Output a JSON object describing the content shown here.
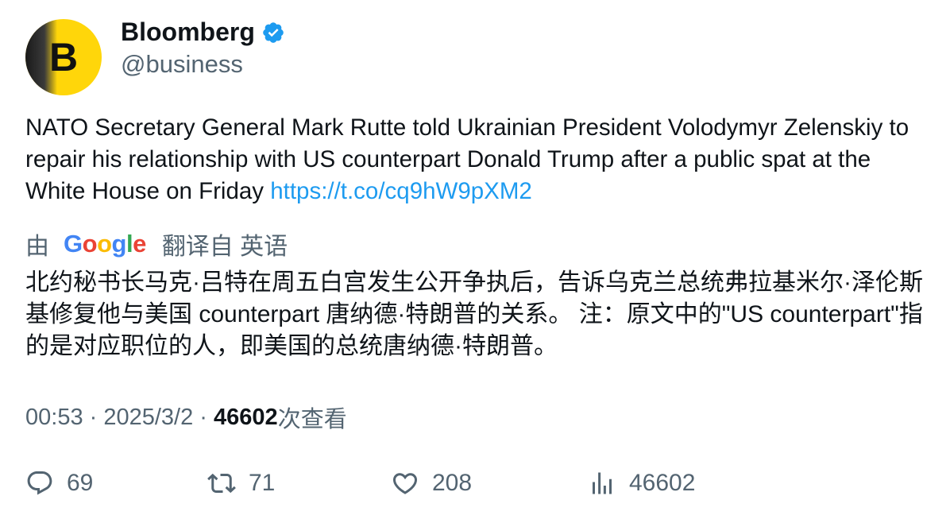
{
  "author": {
    "display_name": "Bloomberg",
    "handle": "@business",
    "avatar_letter": "B",
    "verified": true,
    "verified_color": "#1d9bf0",
    "avatar_color": "#ffd60a"
  },
  "tweet": {
    "text": "NATO Secretary General Mark Rutte told Ukrainian President Volodymyr Zelenskiy to repair his relationship with US counterpart Donald Trump after a public spat at the White House on Friday ",
    "link": "https://t.co/cq9hW9pXM2",
    "link_color": "#1d9bf0"
  },
  "translation": {
    "prefix": "由",
    "provider": "Google",
    "suffix": "翻译自 英语",
    "text": "北约秘书长马克·吕特在周五白宫发生公开争执后，告诉乌克兰总统弗拉基米尔·泽伦斯基修复他与美国 counterpart 唐纳德·特朗普的关系。 注：原文中的\"US counterpart\"指的是对应职位的人，即美国的总统唐纳德·特朗普。"
  },
  "meta": {
    "time": "00:53",
    "separator": " · ",
    "date": "2025/3/2",
    "views": "46602",
    "views_label": "次查看"
  },
  "actions": {
    "replies": "69",
    "retweets": "71",
    "likes": "208",
    "views": "46602",
    "icons": [
      "reply-icon",
      "retweet-icon",
      "like-icon",
      "views-icon"
    ]
  }
}
